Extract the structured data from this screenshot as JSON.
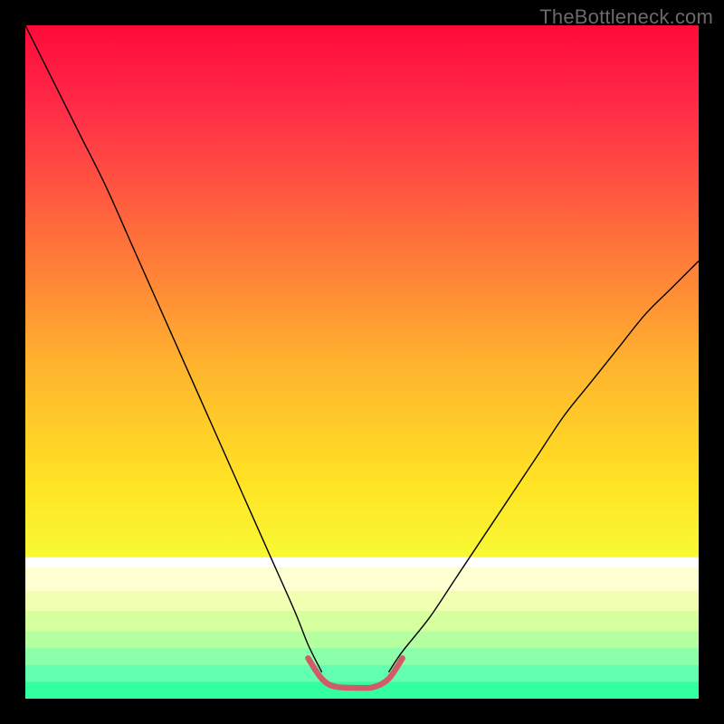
{
  "watermark": "TheBottleneck.com",
  "chart_data": {
    "type": "line",
    "title": "",
    "xlabel": "",
    "ylabel": "",
    "xlim": [
      0,
      100
    ],
    "ylim": [
      0,
      100
    ],
    "grid": false,
    "legend": false,
    "background": {
      "type": "vertical-gradient",
      "stops": [
        {
          "pos": 0.0,
          "color": "#ff0a3a"
        },
        {
          "pos": 0.12,
          "color": "#ff2b48"
        },
        {
          "pos": 0.3,
          "color": "#ff6a3c"
        },
        {
          "pos": 0.5,
          "color": "#ffb22e"
        },
        {
          "pos": 0.68,
          "color": "#ffe324"
        },
        {
          "pos": 0.82,
          "color": "#f6ff3a"
        },
        {
          "pos": 0.9,
          "color": "#cfff7a"
        },
        {
          "pos": 0.95,
          "color": "#8cffb0"
        },
        {
          "pos": 1.0,
          "color": "#2fff9a"
        }
      ]
    },
    "series": [
      {
        "name": "left-curve",
        "color": "#000000",
        "width": 1.4,
        "x": [
          0,
          4,
          8,
          12,
          16,
          20,
          24,
          28,
          32,
          36,
          40,
          42,
          44
        ],
        "y": [
          100,
          92,
          84,
          76,
          67,
          58,
          49,
          40,
          31,
          22,
          13,
          8,
          4
        ]
      },
      {
        "name": "right-curve",
        "color": "#000000",
        "width": 1.4,
        "x": [
          54,
          56,
          60,
          64,
          68,
          72,
          76,
          80,
          84,
          88,
          92,
          96,
          100
        ],
        "y": [
          4,
          7,
          12,
          18,
          24,
          30,
          36,
          42,
          47,
          52,
          57,
          61,
          65
        ]
      },
      {
        "name": "bottom-highlight",
        "color": "#cf5c66",
        "width": 6.5,
        "x": [
          42,
          44,
          46,
          50,
          52,
          54,
          56
        ],
        "y": [
          6,
          3,
          1.8,
          1.6,
          1.8,
          3,
          6
        ]
      }
    ],
    "bottom_bands": [
      {
        "color": "#ffffff",
        "from": 79,
        "to": 80.5
      },
      {
        "color": "#feffd2",
        "from": 80.5,
        "to": 84
      },
      {
        "color": "#f1ffb2",
        "from": 84,
        "to": 87
      },
      {
        "color": "#d6ff9e",
        "from": 87,
        "to": 90
      },
      {
        "color": "#b4ffa0",
        "from": 90,
        "to": 92.5
      },
      {
        "color": "#8dffab",
        "from": 92.5,
        "to": 95
      },
      {
        "color": "#63ffb0",
        "from": 95,
        "to": 97.5
      },
      {
        "color": "#34ff9f",
        "from": 97.5,
        "to": 100
      }
    ]
  }
}
